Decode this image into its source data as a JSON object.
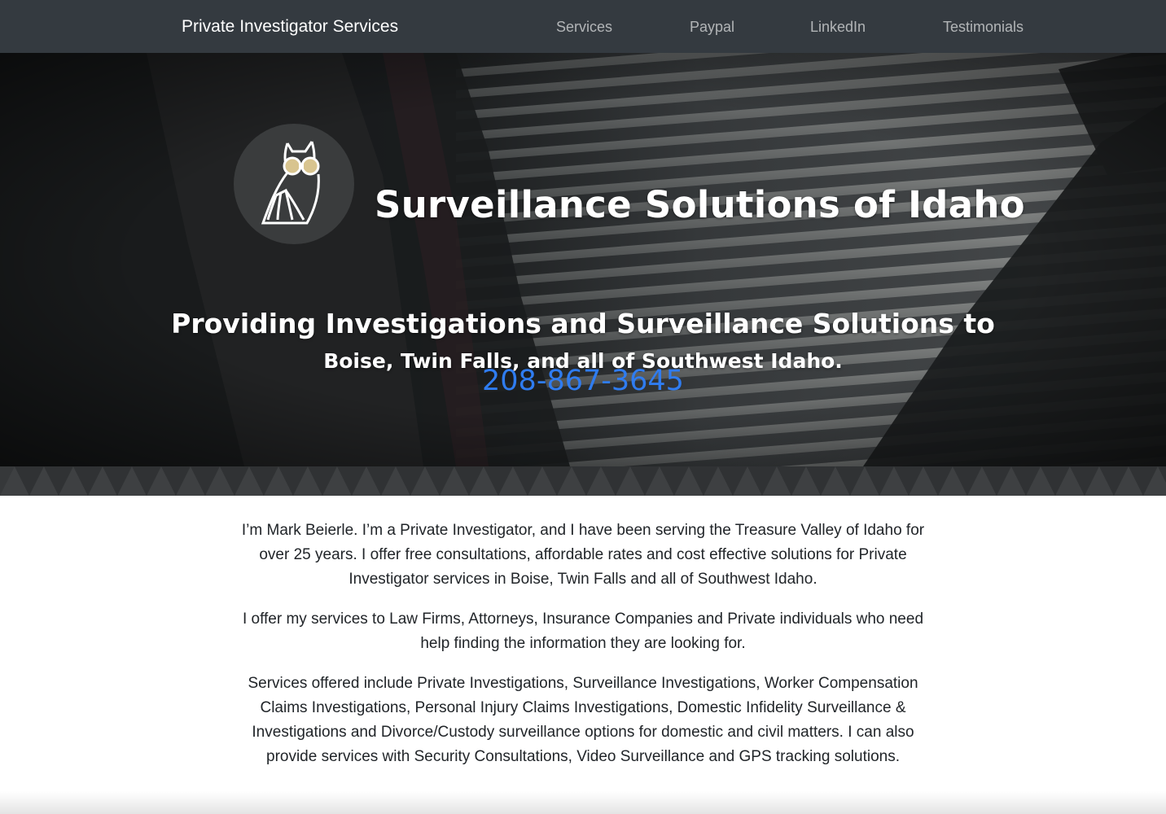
{
  "navbar": {
    "brand": "Private Investigator Services",
    "links": [
      {
        "label": "Services"
      },
      {
        "label": "Paypal"
      },
      {
        "label": "LinkedIn"
      },
      {
        "label": "Testimonials"
      }
    ]
  },
  "hero": {
    "logo_icon": "owl-with-binoculars-icon",
    "title": "Surveillance Solutions of Idaho",
    "subtitle": "Providing Investigations and Surveillance Solutions to",
    "region": "Boise, Twin Falls, and all of Southwest Idaho.",
    "phone": "208-867-3645"
  },
  "colors": {
    "navbar_bg": "#343a40",
    "phone_link": "#2f7cf0",
    "body_text": "#212529"
  },
  "content": {
    "paragraphs": [
      "I’m Mark Beierle. I’m a Private Investigator, and I have been serving the Treasure Valley of Idaho for over 25 years. I offer free consultations, affordable rates and cost effective solutions for Private Investigator services in Boise, Twin Falls and all of Southwest Idaho.",
      "I offer my services to Law Firms, Attorneys, Insurance Companies and Private individuals who need help finding the information they are looking for.",
      "Services offered include Private Investigations, Surveillance Investigations, Worker Compensation Claims Investigations, Personal Injury Claims Investigations, Domestic Infidelity Surveillance & Investigations and Divorce/Custody surveillance options for domestic and civil matters. I can also provide services with Security Consultations, Video Surveillance and GPS tracking solutions."
    ]
  }
}
